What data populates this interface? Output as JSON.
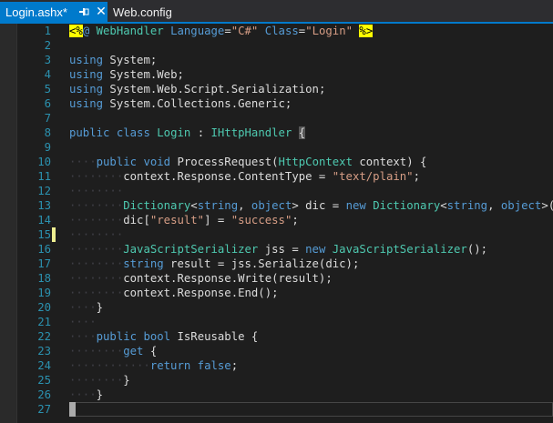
{
  "tabs": {
    "active": {
      "label": "Login.ashx*"
    },
    "inactive": {
      "label": "Web.config"
    },
    "pin_glyph": "⊣",
    "close_glyph": "✕"
  },
  "editor": {
    "changed_line": 15,
    "cursor_line": 27,
    "lines": [
      {
        "n": "1",
        "tokens": [
          [
            "dir",
            "<%"
          ],
          [
            "kw",
            "@ "
          ],
          [
            "ty",
            "WebHandler"
          ],
          [
            "pl",
            " "
          ],
          [
            "kw",
            "Language"
          ],
          [
            "pl",
            "="
          ],
          [
            "st",
            "\"C#\""
          ],
          [
            "pl",
            " "
          ],
          [
            "kw",
            "Class"
          ],
          [
            "pl",
            "="
          ],
          [
            "st",
            "\"Login\""
          ],
          [
            "pl",
            " "
          ],
          [
            "dir",
            "%>"
          ]
        ]
      },
      {
        "n": "2",
        "tokens": []
      },
      {
        "n": "3",
        "tokens": [
          [
            "kw",
            "using"
          ],
          [
            "pl",
            " System;"
          ]
        ]
      },
      {
        "n": "4",
        "tokens": [
          [
            "kw",
            "using"
          ],
          [
            "pl",
            " System.Web;"
          ]
        ]
      },
      {
        "n": "5",
        "tokens": [
          [
            "kw",
            "using"
          ],
          [
            "pl",
            " System.Web.Script.Serialization;"
          ]
        ]
      },
      {
        "n": "6",
        "tokens": [
          [
            "kw",
            "using"
          ],
          [
            "pl",
            " System.Collections.Generic;"
          ]
        ]
      },
      {
        "n": "7",
        "tokens": []
      },
      {
        "n": "8",
        "tokens": [
          [
            "kw",
            "public"
          ],
          [
            "pl",
            " "
          ],
          [
            "kw",
            "class"
          ],
          [
            "pl",
            " "
          ],
          [
            "ty",
            "Login"
          ],
          [
            "pl",
            " : "
          ],
          [
            "ty",
            "IHttpHandler"
          ],
          [
            "pl",
            " "
          ],
          [
            "sel",
            "{"
          ]
        ]
      },
      {
        "n": "9",
        "tokens": []
      },
      {
        "n": "10",
        "tokens": [
          [
            "ws",
            "····"
          ],
          [
            "kw",
            "public"
          ],
          [
            "pl",
            " "
          ],
          [
            "kw",
            "void"
          ],
          [
            "pl",
            " ProcessRequest("
          ],
          [
            "ty",
            "HttpContext"
          ],
          [
            "pl",
            " context) {"
          ]
        ]
      },
      {
        "n": "11",
        "tokens": [
          [
            "ws",
            "········"
          ],
          [
            "pl",
            "context.Response.ContentType = "
          ],
          [
            "st",
            "\"text/plain\""
          ],
          [
            "pl",
            ";"
          ]
        ]
      },
      {
        "n": "12",
        "tokens": [
          [
            "ws",
            "········"
          ]
        ]
      },
      {
        "n": "13",
        "tokens": [
          [
            "ws",
            "········"
          ],
          [
            "ty",
            "Dictionary"
          ],
          [
            "pl",
            "<"
          ],
          [
            "kw",
            "string"
          ],
          [
            "pl",
            ", "
          ],
          [
            "kw",
            "object"
          ],
          [
            "pl",
            "> dic = "
          ],
          [
            "kw",
            "new"
          ],
          [
            "pl",
            " "
          ],
          [
            "ty",
            "Dictionary"
          ],
          [
            "pl",
            "<"
          ],
          [
            "kw",
            "string"
          ],
          [
            "pl",
            ", "
          ],
          [
            "kw",
            "object"
          ],
          [
            "pl",
            ">();"
          ]
        ]
      },
      {
        "n": "14",
        "tokens": [
          [
            "ws",
            "········"
          ],
          [
            "pl",
            "dic["
          ],
          [
            "st",
            "\"result\""
          ],
          [
            "pl",
            "] = "
          ],
          [
            "st",
            "\"success\""
          ],
          [
            "pl",
            ";"
          ]
        ]
      },
      {
        "n": "15",
        "tokens": [
          [
            "ws",
            "········"
          ]
        ]
      },
      {
        "n": "16",
        "tokens": [
          [
            "ws",
            "········"
          ],
          [
            "ty",
            "JavaScriptSerializer"
          ],
          [
            "pl",
            " jss = "
          ],
          [
            "kw",
            "new"
          ],
          [
            "pl",
            " "
          ],
          [
            "ty",
            "JavaScriptSerializer"
          ],
          [
            "pl",
            "();"
          ]
        ]
      },
      {
        "n": "17",
        "tokens": [
          [
            "ws",
            "········"
          ],
          [
            "kw",
            "string"
          ],
          [
            "pl",
            " result = jss.Serialize(dic);"
          ]
        ]
      },
      {
        "n": "18",
        "tokens": [
          [
            "ws",
            "········"
          ],
          [
            "pl",
            "context.Response.Write(result);"
          ]
        ]
      },
      {
        "n": "19",
        "tokens": [
          [
            "ws",
            "········"
          ],
          [
            "pl",
            "context.Response.End();"
          ]
        ]
      },
      {
        "n": "20",
        "tokens": [
          [
            "ws",
            "····"
          ],
          [
            "pl",
            "}"
          ]
        ]
      },
      {
        "n": "21",
        "tokens": [
          [
            "ws",
            "····"
          ]
        ]
      },
      {
        "n": "22",
        "tokens": [
          [
            "ws",
            "····"
          ],
          [
            "kw",
            "public"
          ],
          [
            "pl",
            " "
          ],
          [
            "kw",
            "bool"
          ],
          [
            "pl",
            " IsReusable {"
          ]
        ]
      },
      {
        "n": "23",
        "tokens": [
          [
            "ws",
            "········"
          ],
          [
            "kw",
            "get"
          ],
          [
            "pl",
            " {"
          ]
        ]
      },
      {
        "n": "24",
        "tokens": [
          [
            "ws",
            "············"
          ],
          [
            "kw",
            "return"
          ],
          [
            "pl",
            " "
          ],
          [
            "kw",
            "false"
          ],
          [
            "pl",
            ";"
          ]
        ]
      },
      {
        "n": "25",
        "tokens": [
          [
            "ws",
            "········"
          ],
          [
            "pl",
            "}"
          ]
        ]
      },
      {
        "n": "26",
        "tokens": [
          [
            "ws",
            "····"
          ],
          [
            "pl",
            "}"
          ]
        ]
      },
      {
        "n": "27",
        "tokens": []
      }
    ]
  }
}
